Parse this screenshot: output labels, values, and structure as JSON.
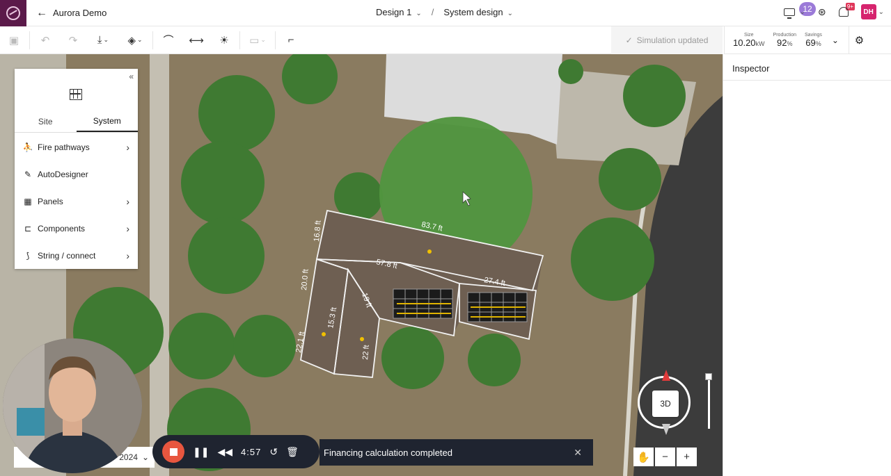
{
  "header": {
    "back_label": "Aurora Demo",
    "crumb_design": "Design 1",
    "crumb_separator": "/",
    "crumb_view": "System design",
    "collab_count": "12",
    "notif_count": "9+",
    "avatar_initials": "DH"
  },
  "toolbar": {
    "simulation_status": "Simulation updated"
  },
  "stats": {
    "size_label": "Size",
    "size_value": "10.20",
    "size_unit": "kW",
    "production_label": "Production",
    "production_value": "92",
    "production_unit": "%",
    "savings_label": "Savings",
    "savings_value": "69",
    "savings_unit": "%"
  },
  "inspector": {
    "title": "Inspector"
  },
  "panel": {
    "tabs": [
      "Site",
      "System"
    ],
    "active_tab": "System",
    "items": [
      {
        "label": "Fire pathways",
        "icon": "fire-pathway-icon",
        "has_chevron": true
      },
      {
        "label": "AutoDesigner",
        "icon": "wand-icon",
        "has_chevron": false
      },
      {
        "label": "Panels",
        "icon": "panels-icon",
        "has_chevron": true
      },
      {
        "label": "Components",
        "icon": "component-icon",
        "has_chevron": true
      },
      {
        "label": "String / connect",
        "icon": "string-icon",
        "has_chevron": true
      }
    ]
  },
  "map": {
    "labels": [
      "83.7 ft",
      "57.8 ft",
      "27.4 ft",
      "19 ft",
      "15.3 ft",
      "22 ft",
      "20.0 ft",
      "22.1 ft",
      "16.8 ft"
    ],
    "compass_label": "3D",
    "layer_select_value": "2024"
  },
  "recorder": {
    "time": "4:57"
  },
  "toast": {
    "message": "Financing calculation completed"
  }
}
